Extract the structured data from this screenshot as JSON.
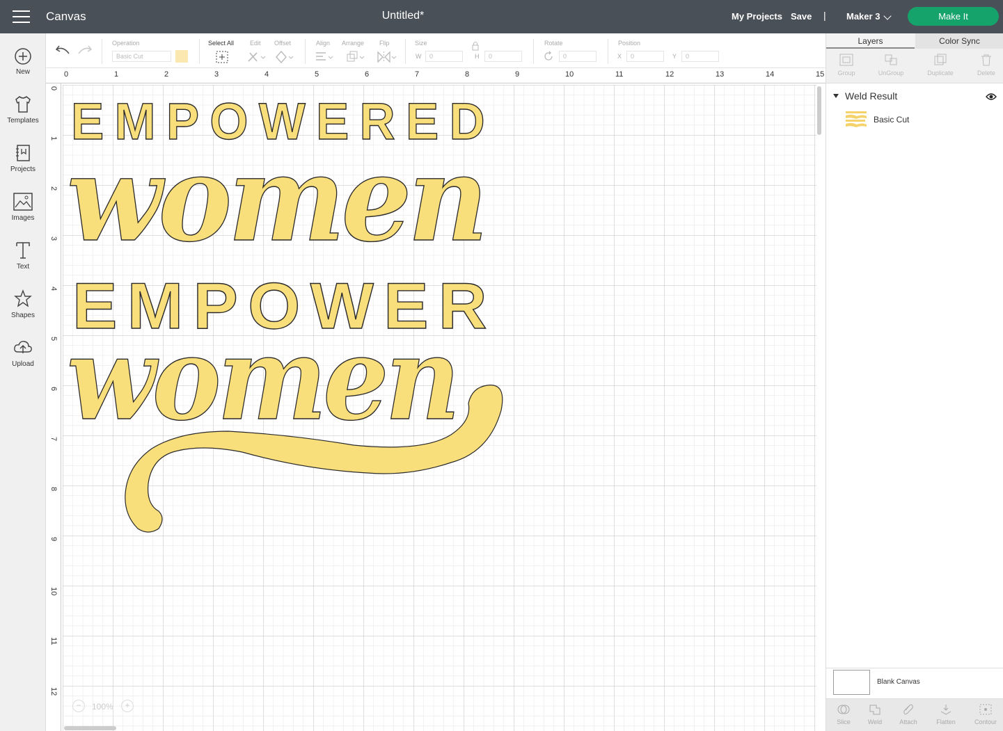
{
  "topbar": {
    "app_name": "Canvas",
    "document_title": "Untitled*",
    "my_projects": "My Projects",
    "save": "Save",
    "separator": "|",
    "machine": "Maker 3",
    "make_it": "Make It"
  },
  "leftbar": {
    "items": [
      {
        "label": "New",
        "icon": "plus-circle-icon"
      },
      {
        "label": "Templates",
        "icon": "shirt-icon"
      },
      {
        "label": "Projects",
        "icon": "notebook-icon"
      },
      {
        "label": "Images",
        "icon": "image-icon"
      },
      {
        "label": "Text",
        "icon": "text-icon"
      },
      {
        "label": "Shapes",
        "icon": "shapes-icon"
      },
      {
        "label": "Upload",
        "icon": "cloud-upload-icon"
      }
    ]
  },
  "toolbar": {
    "operation_label": "Operation",
    "operation_value": "Basic Cut",
    "select_all": "Select All",
    "edit": "Edit",
    "offset": "Offset",
    "align": "Align",
    "arrange": "Arrange",
    "flip": "Flip",
    "size": "Size",
    "w_label": "W",
    "h_label": "H",
    "w_value": "0",
    "h_value": "0",
    "rotate": "Rotate",
    "rotate_value": "0",
    "position": "Position",
    "x_label": "X",
    "y_label": "Y",
    "x_value": "0",
    "y_value": "0",
    "operation_color": "#fbe8b0"
  },
  "canvas": {
    "ruler_top": [
      "0",
      "1",
      "2",
      "3",
      "4",
      "5",
      "6",
      "7",
      "8",
      "9",
      "10",
      "11",
      "12",
      "13",
      "14",
      "15"
    ],
    "ruler_left": [
      "0",
      "1",
      "2",
      "3",
      "4",
      "5",
      "6",
      "7",
      "8",
      "9",
      "10",
      "11",
      "12"
    ],
    "zoom": "100%",
    "zoom_minus": "−",
    "zoom_plus": "+",
    "design_fill": "#f9de7c",
    "design_stroke": "#2a2a2a",
    "design_text": {
      "line1": "EMPOWERED",
      "line2": "women",
      "line3": "EMPOWER",
      "line4": "women"
    }
  },
  "rightpanel": {
    "tabs": [
      "Layers",
      "Color Sync"
    ],
    "actions": [
      "Group",
      "UnGroup",
      "Duplicate",
      "Delete"
    ],
    "group_name": "Weld Result",
    "layer_name": "Basic Cut",
    "blank_canvas": "Blank Canvas",
    "bottom_actions": [
      "Slice",
      "Weld",
      "Attach",
      "Flatten",
      "Contour"
    ]
  }
}
